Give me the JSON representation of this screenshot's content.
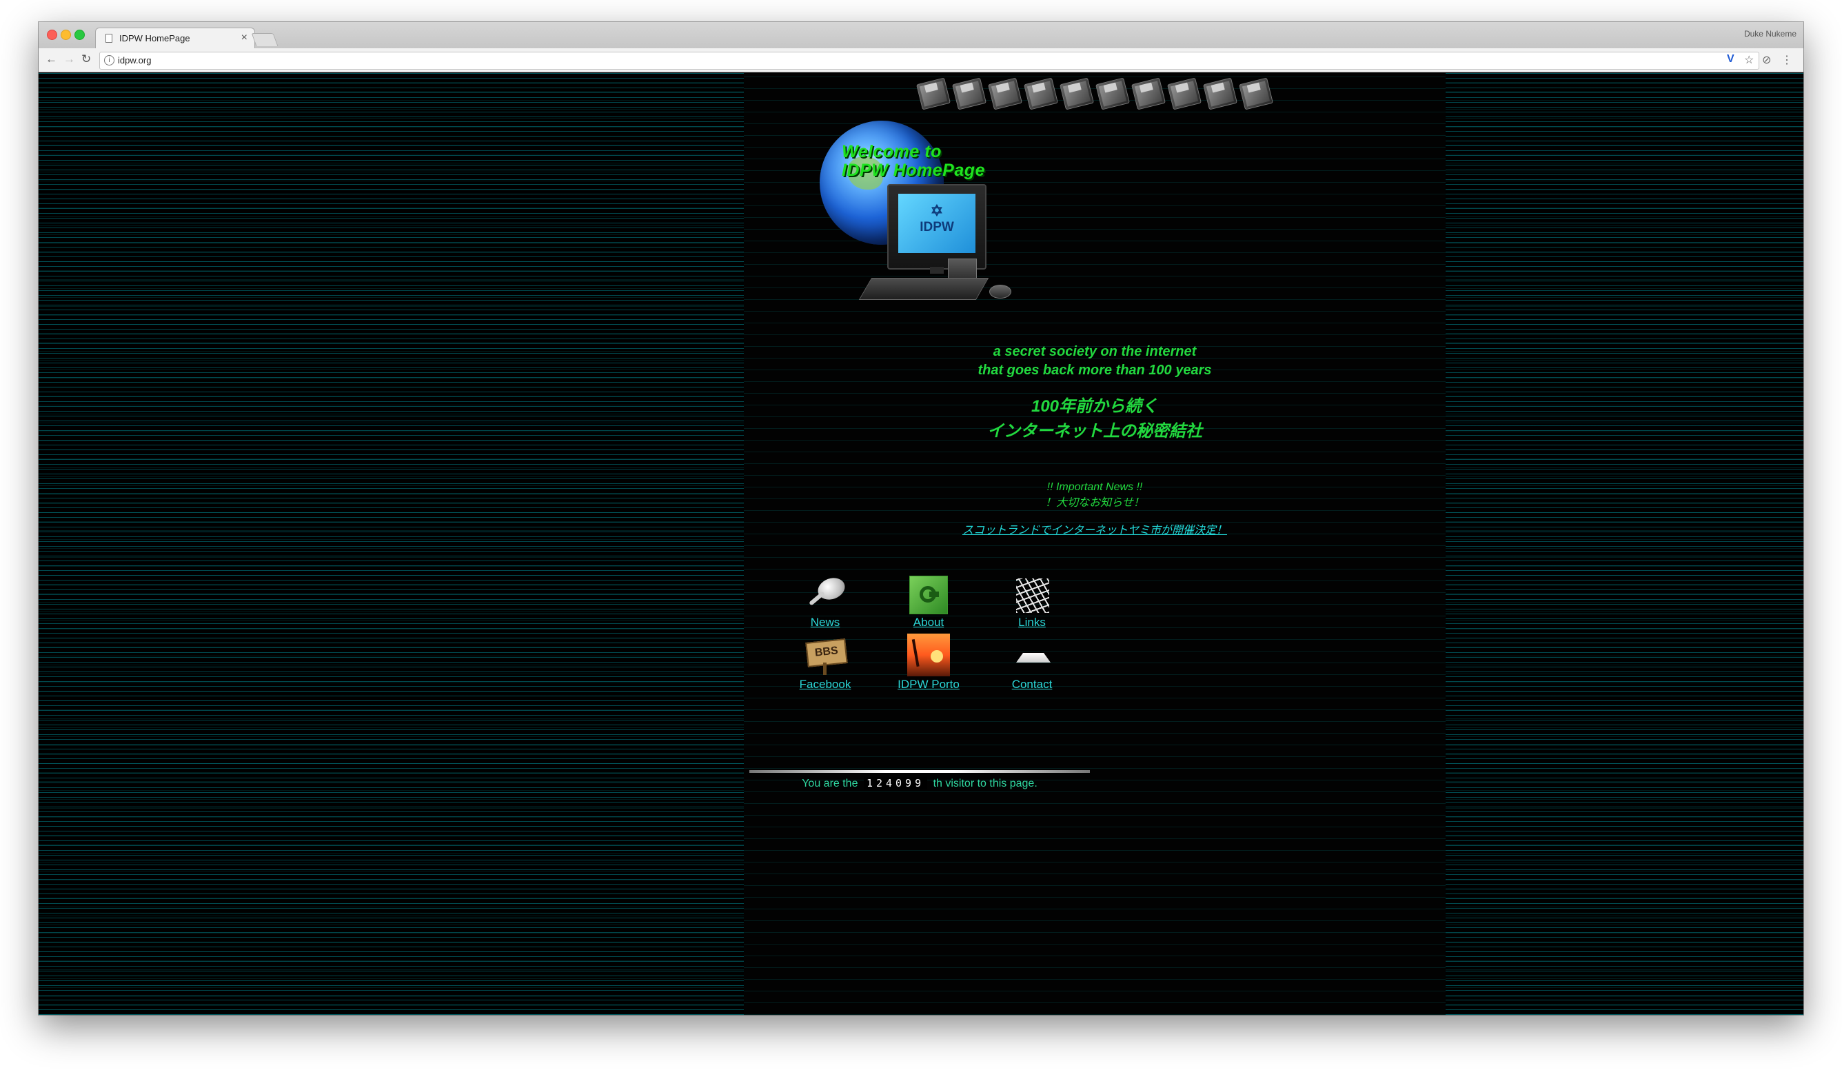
{
  "browser": {
    "tab_title": "IDPW HomePage",
    "tab_close": "×",
    "profile_name": "Duke Nukeme",
    "url": "idpw.org",
    "icons": {
      "back": "arrow-left",
      "forward": "arrow-right",
      "reload": "reload",
      "info": "info",
      "extension": "vivaldi-v",
      "bookmark": "star",
      "shield": "shield",
      "menu": "kebab-menu"
    }
  },
  "page": {
    "floppy_count": 10,
    "welcome_line1": "Welcome to",
    "welcome_line2": "IDPW HomePage",
    "monitor_text": "IDPW",
    "tagline_en_line1": "a secret society on the internet",
    "tagline_en_line2": "that goes back more than 100 years",
    "tagline_ja_line1": "100年前から続く",
    "tagline_ja_line2": "インターネット上の秘密結社",
    "news_title_en": "!! Important News !!",
    "news_title_ja": "！大切なお知らせ！",
    "news_link": "スコットランドでインターネットヤミ市が開催決定！",
    "nav": [
      {
        "label": "News",
        "icon": "magnifier-icon"
      },
      {
        "label": "About",
        "icon": "green-disc-icon"
      },
      {
        "label": "Links",
        "icon": "net-icon"
      },
      {
        "label": "Facebook",
        "icon": "bbs-sign-icon"
      },
      {
        "label": "IDPW Porto",
        "icon": "palm-sunset-icon"
      },
      {
        "label": "Contact",
        "icon": "envelope-icon"
      }
    ],
    "counter_prefix": "You are the",
    "counter_value": "124099",
    "counter_suffix": "th visitor to this page."
  },
  "colors": {
    "text_green": "#22d93f",
    "link_cyan": "#2bd7d7",
    "background": "#000000"
  }
}
